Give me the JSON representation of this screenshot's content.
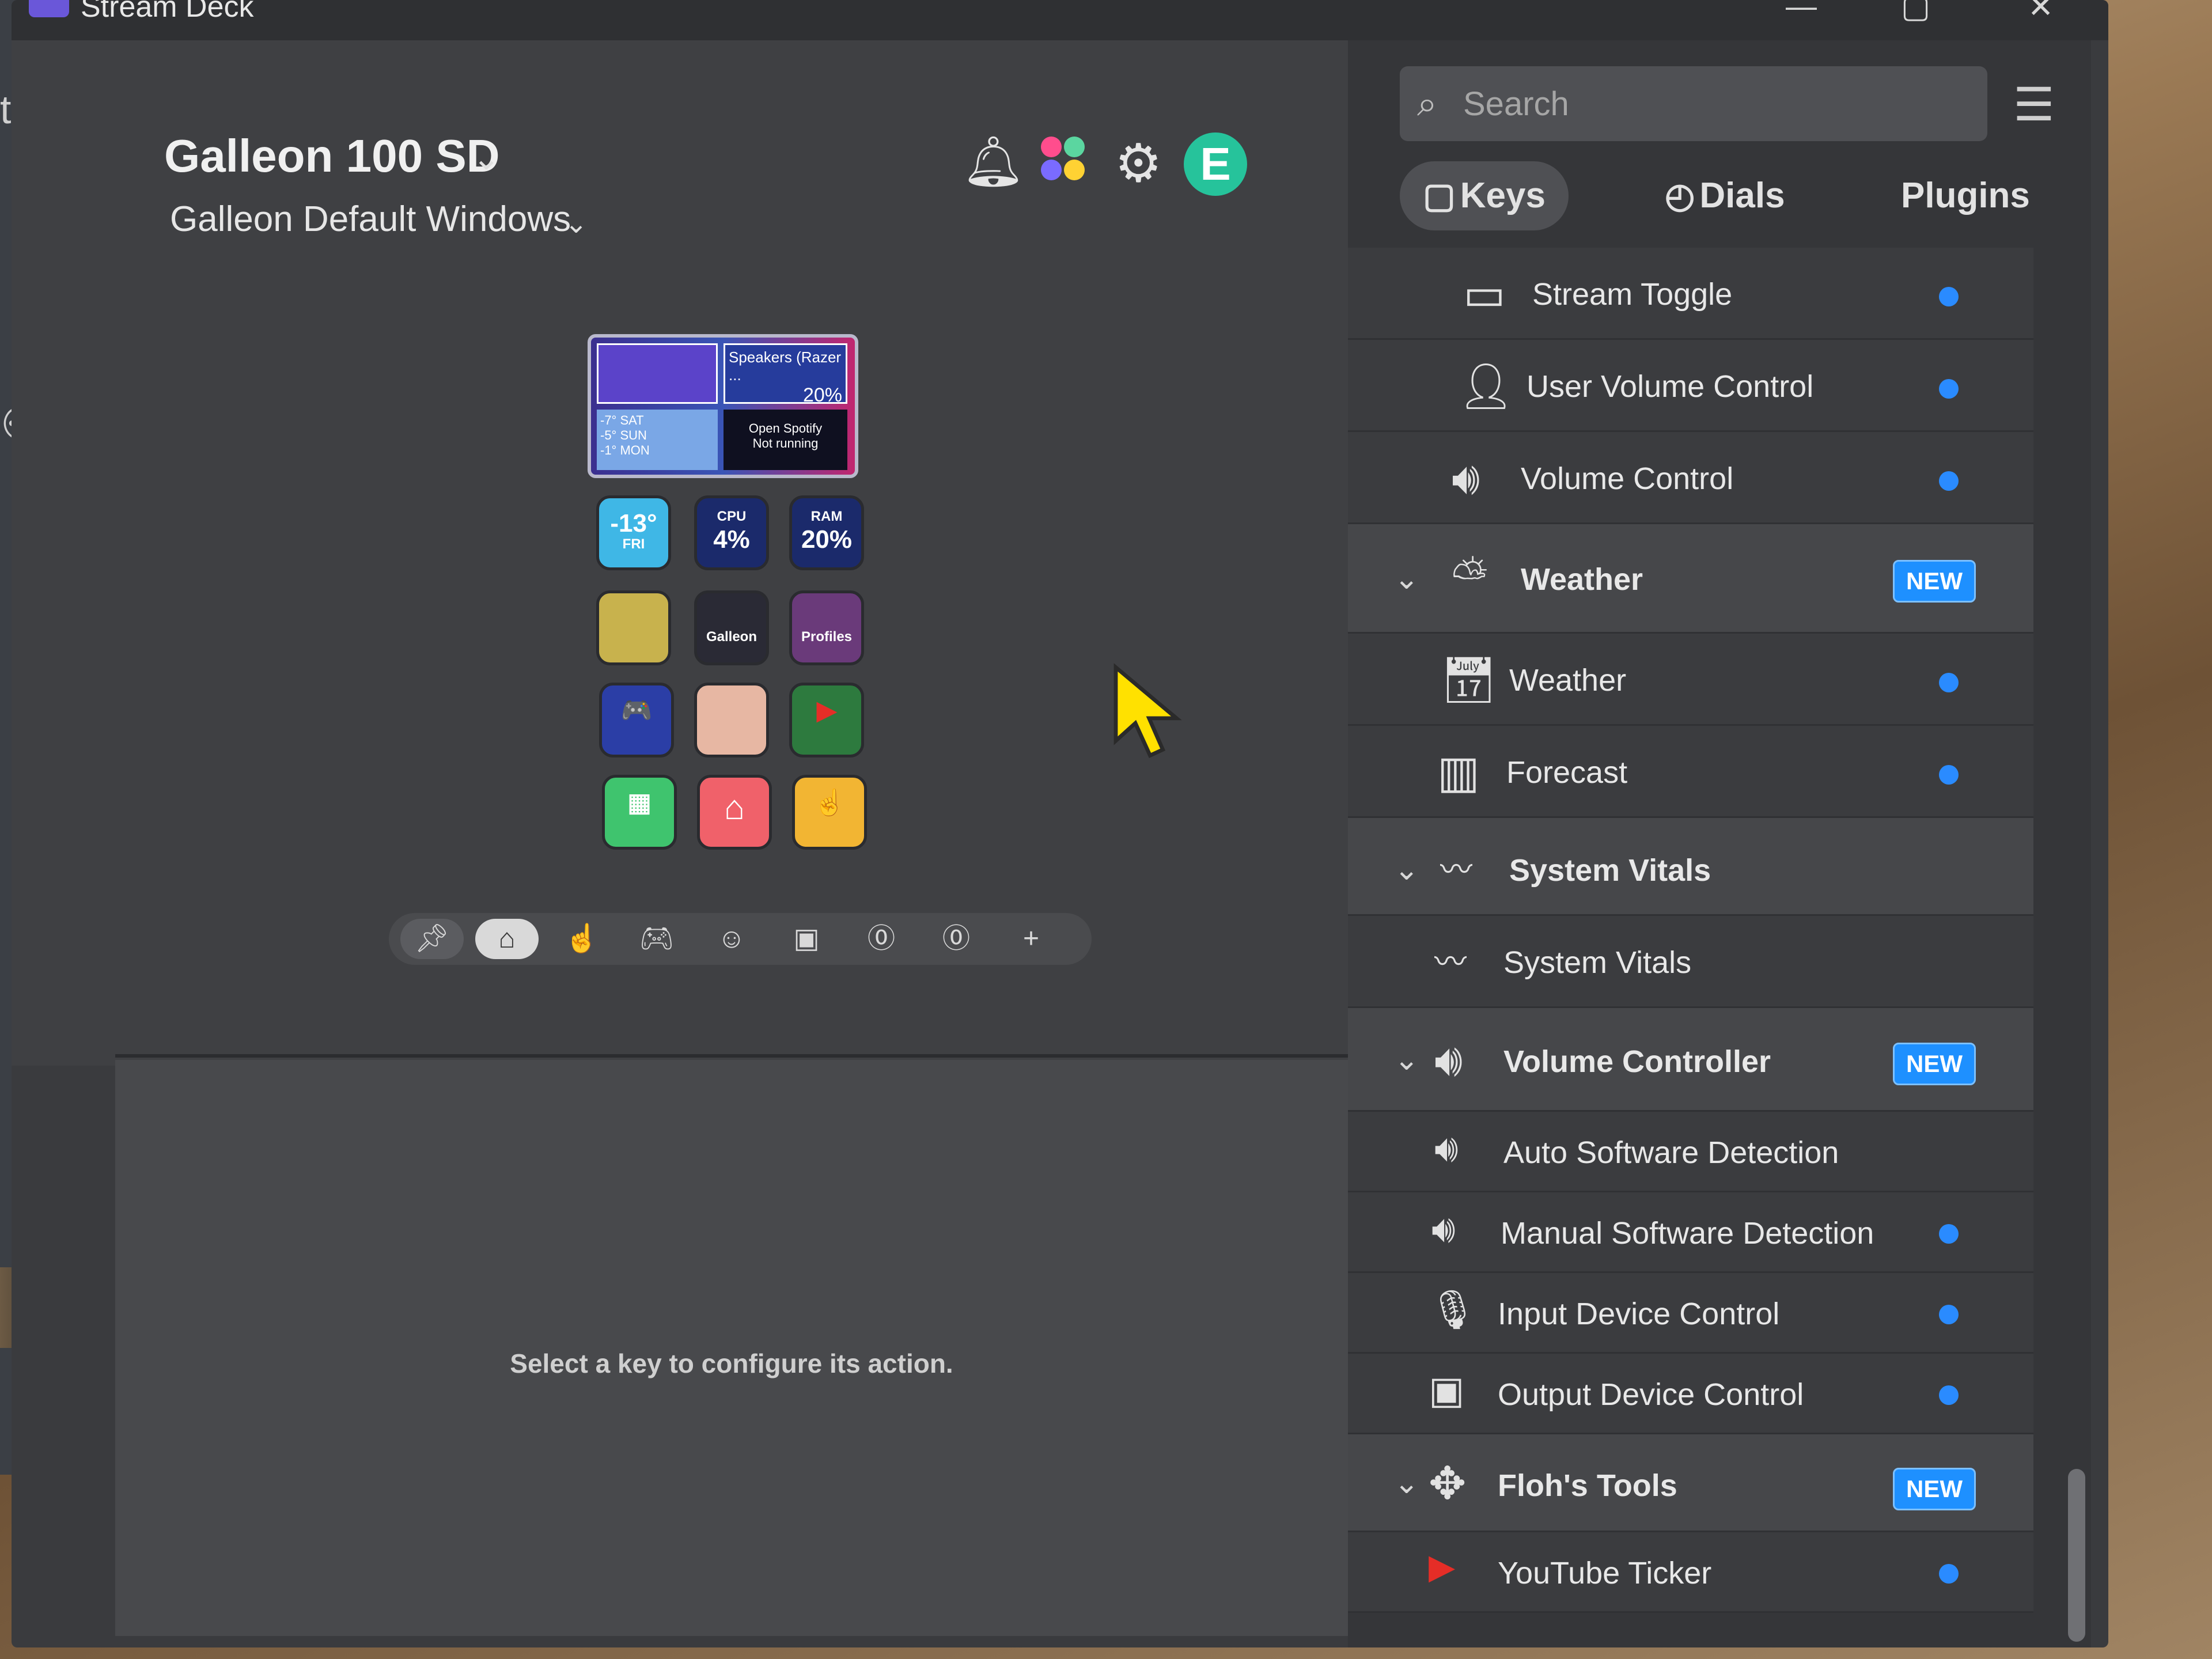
{
  "window": {
    "title": "Stream Deck"
  },
  "header": {
    "device_name": "Galleon 100 SD",
    "profile_name": "Galleon Default Windows",
    "avatar_letter": "E",
    "icons": [
      "bell-icon",
      "marketplace-icon",
      "gear-icon"
    ]
  },
  "lcd": {
    "speakers_label": "Speakers (Razer ...",
    "volume": "20%",
    "weather_days": [
      "-7° SAT",
      "-5° SUN",
      "-1° MON"
    ],
    "spotify_text": "Open Spotify",
    "spotify_status": "Not running"
  },
  "keys": [
    {
      "main": "-13°",
      "sub": "FRI",
      "bg": "#3fb7e6"
    },
    {
      "main": "4%",
      "sub": "CPU",
      "bg": "#1b2a6b"
    },
    {
      "main": "20%",
      "sub": "RAM",
      "bg": "#1b2a6b"
    },
    {
      "main": "",
      "sub": "",
      "bg": "#c8b24d"
    },
    {
      "main": "",
      "sub": "Galleon",
      "bg": "#2a2a35"
    },
    {
      "main": "",
      "sub": "Profiles",
      "bg": "#6a3a7a"
    },
    {
      "main": "🎮",
      "sub": "",
      "bg": "#2b3ea6"
    },
    {
      "main": "",
      "sub": "",
      "bg": "#e7b7a3"
    },
    {
      "main": "▶",
      "sub": "",
      "bg": "#2d7a3e"
    },
    {
      "main": "▦",
      "sub": "",
      "bg": "#3fc46e"
    },
    {
      "main": "⌂",
      "sub": "",
      "bg": "#f0616a"
    },
    {
      "main": "☝",
      "sub": "",
      "bg": "#f2b533"
    }
  ],
  "pagebar": {
    "items": [
      "pin-icon",
      "home-icon",
      "touch-icon",
      "gamepad-icon",
      "smile-icon",
      "twitch-icon",
      "page-0-icon",
      "page-0-icon",
      "add-page-icon"
    ],
    "add_label": "+"
  },
  "bottom_hint": "Select a key to configure its action.",
  "search": {
    "placeholder": "Search"
  },
  "tabs": [
    {
      "label": "Keys",
      "active": true
    },
    {
      "label": "Dials",
      "active": false
    },
    {
      "label": "Plugins",
      "active": false
    }
  ],
  "actions": [
    {
      "label": "Stream Toggle",
      "type": "item",
      "dot": true
    },
    {
      "label": "User Volume Control",
      "type": "item",
      "dot": true
    },
    {
      "label": "Volume Control",
      "type": "item",
      "dot": true
    },
    {
      "label": "Weather",
      "type": "category",
      "badge": "NEW"
    },
    {
      "label": "Weather",
      "type": "item",
      "dot": true
    },
    {
      "label": "Forecast",
      "type": "item",
      "dot": true
    },
    {
      "label": "System Vitals",
      "type": "category"
    },
    {
      "label": "System Vitals",
      "type": "item",
      "dot": false
    },
    {
      "label": "Volume Controller",
      "type": "category",
      "badge": "NEW"
    },
    {
      "label": "Auto Software Detection",
      "type": "item",
      "dot": false
    },
    {
      "label": "Manual Software Detection",
      "type": "item",
      "dot": true
    },
    {
      "label": "Input Device Control",
      "type": "item",
      "dot": true
    },
    {
      "label": "Output Device Control",
      "type": "item",
      "dot": true
    },
    {
      "label": "Floh's Tools",
      "type": "category",
      "badge": "NEW"
    },
    {
      "label": "YouTube Ticker",
      "type": "item",
      "dot": true
    }
  ],
  "colors": {
    "accent": "#2a8bff",
    "avatar": "#26c39b",
    "pointer": "#ffe100"
  }
}
